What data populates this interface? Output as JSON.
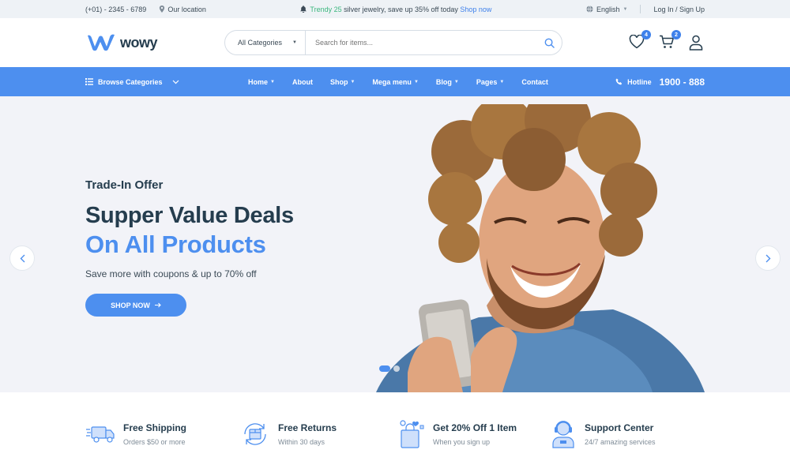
{
  "topbar": {
    "phone": "(+01) - 2345 - 6789",
    "location": "Our location",
    "promo_prefix": "Trendy 25",
    "promo_text": " silver jewelry, save up 35% off today ",
    "promo_link": "Shop now",
    "language": "English",
    "login": "Log In / Sign Up"
  },
  "header": {
    "logo_text": "wowy",
    "category_select": "All Categories",
    "search_placeholder": "Search for items...",
    "wishlist_count": "4",
    "cart_count": "2"
  },
  "nav": {
    "browse": "Browse Categories",
    "items": [
      "Home",
      "About",
      "Shop",
      "Mega menu",
      "Blog",
      "Pages",
      "Contact"
    ],
    "hotline_label": "Hotline",
    "hotline_number": "1900 - 888"
  },
  "hero": {
    "subtitle": "Trade-In Offer",
    "title_line1": "Supper Value Deals",
    "title_line2": "On All Products",
    "description": "Save more with coupons & up to 70% off",
    "button": "SHOP NOW",
    "slide_active": 1,
    "slide_count": 2
  },
  "features": [
    {
      "icon": "truck-icon",
      "title": "Free Shipping",
      "sub": "Orders $50 or more"
    },
    {
      "icon": "returns-icon",
      "title": "Free Returns",
      "sub": "Within 30 days"
    },
    {
      "icon": "gift-bag-icon",
      "title": "Get 20% Off 1 Item",
      "sub": "When you sign up"
    },
    {
      "icon": "support-agent-icon",
      "title": "Support Center",
      "sub": "24/7 amazing services"
    }
  ],
  "colors": {
    "brand": "#4d8fef",
    "dark_text": "#253d4e",
    "topbar_bg": "#eef2f6",
    "hero_bg": "#f2f3f8",
    "green": "#3bb77e"
  }
}
